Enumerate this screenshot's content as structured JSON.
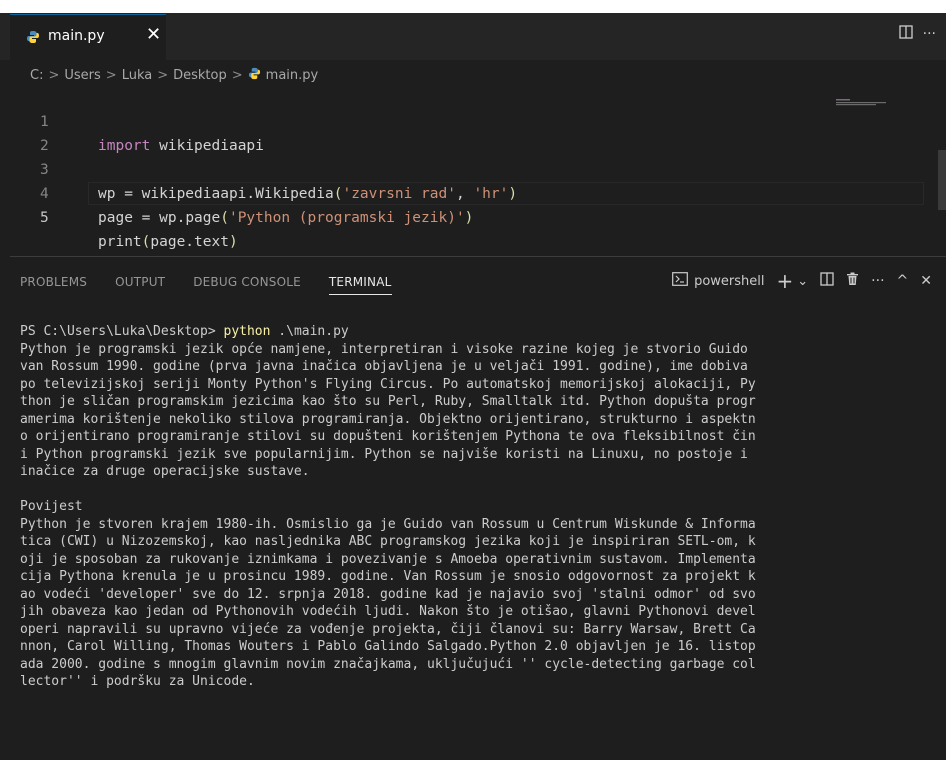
{
  "tab": {
    "filename": "main.py",
    "close_glyph": "✕"
  },
  "toolbar": {
    "split_icon": "split-editor-icon",
    "more_glyph": "···"
  },
  "breadcrumb": {
    "items": [
      "C:",
      "Users",
      "Luka",
      "Desktop",
      "main.py"
    ],
    "separator": ">"
  },
  "editor": {
    "lines": [
      {
        "num": "1",
        "tokens": [
          {
            "t": "import",
            "c": "kw"
          },
          {
            "t": " wikipediaapi",
            "c": "id"
          }
        ]
      },
      {
        "num": "2",
        "tokens": []
      },
      {
        "num": "3",
        "tokens": [
          {
            "t": "wp",
            "c": "id"
          },
          {
            "t": " = wikipediaapi.",
            "c": "id"
          },
          {
            "t": "Wikipedia",
            "c": "id"
          },
          {
            "t": "(",
            "c": "fn"
          },
          {
            "t": "'zavrsni rad'",
            "c": "str"
          },
          {
            "t": ", ",
            "c": "id"
          },
          {
            "t": "'hr'",
            "c": "str"
          },
          {
            "t": ")",
            "c": "fn"
          }
        ]
      },
      {
        "num": "4",
        "tokens": [
          {
            "t": "page",
            "c": "id"
          },
          {
            "t": " = wp.",
            "c": "id"
          },
          {
            "t": "page",
            "c": "id"
          },
          {
            "t": "(",
            "c": "fn"
          },
          {
            "t": "'Python (programski jezik)'",
            "c": "str"
          },
          {
            "t": ")",
            "c": "fn"
          }
        ]
      },
      {
        "num": "5",
        "tokens": [
          {
            "t": "print",
            "c": "id"
          },
          {
            "t": "(",
            "c": "fn"
          },
          {
            "t": "page.text",
            "c": "id"
          },
          {
            "t": ")",
            "c": "fn"
          }
        ]
      }
    ],
    "active_line": "5"
  },
  "panel": {
    "tabs": [
      "PROBLEMS",
      "OUTPUT",
      "DEBUG CONSOLE",
      "TERMINAL"
    ],
    "active_tab": "TERMINAL",
    "shell_name": "powershell",
    "tool_glyphs": {
      "plus": "+",
      "chevron": "⌄",
      "more": "···",
      "maximize": "^",
      "close": "✕"
    }
  },
  "terminal": {
    "prompt": "PS C:\\Users\\Luka\\Desktop> ",
    "command": "python",
    "args": " .\\main.py",
    "output": "Python je programski jezik opće namjene, interpretiran i visoke razine kojeg je stvorio Guido\nvan Rossum 1990. godine (prva javna inačica objavljena je u veljači 1991. godine), ime dobiva\npo televizijskoj seriji Monty Python's Flying Circus. Po automatskoj memorijskoj alokaciji, Py\nthon je sličan programskim jezicima kao što su Perl, Ruby, Smalltalk itd. Python dopušta progr\namerima korištenje nekoliko stilova programiranja. Objektno orijentirano, strukturno i aspektn\no orijentirano programiranje stilovi su dopušteni korištenjem Pythona te ova fleksibilnost čin\ni Python programski jezik sve popularnijim. Python se najviše koristi na Linuxu, no postoje i\ninačice za druge operacijske sustave.\n\nPovijest\nPython je stvoren krajem 1980-ih. Osmislio ga je Guido van Rossum u Centrum Wiskunde & Informa\ntica (CWI) u Nizozemskoj, kao nasljednika ABC programskog jezika koji je inspiriran SETL-om, k\noji je sposoban za rukovanje iznimkama i povezivanje s Amoeba operativnim sustavom. Implementa\ncija Pythona krenula je u prosincu 1989. godine. Van Rossum je snosio odgovornost za projekt k\nao vodeći 'developer' sve do 12. srpnja 2018. godine kad je najavio svoj 'stalni odmor' od svo\njih obaveza kao jedan od Pythonovih vodećih ljudi. Nakon što je otišao, glavni Pythonovi devel\noperi napravili su upravno vijeće za vođenje projekta, čiji članovi su: Barry Warsaw, Brett Ca\nnnon, Carol Willing, Thomas Wouters i Pablo Galindo Salgado.Python 2.0 objavljen je 16. listop\nada 2000. godine s mnogim glavnim novim značajkama, uključujući '' cycle-detecting garbage col\nlector'' i podršku za Unicode."
  },
  "colors": {
    "background": "#1e1e1e",
    "string": "#ce9178",
    "keyword": "#c586c0",
    "function": "#dcdcaa",
    "command": "#f9f1a5"
  }
}
